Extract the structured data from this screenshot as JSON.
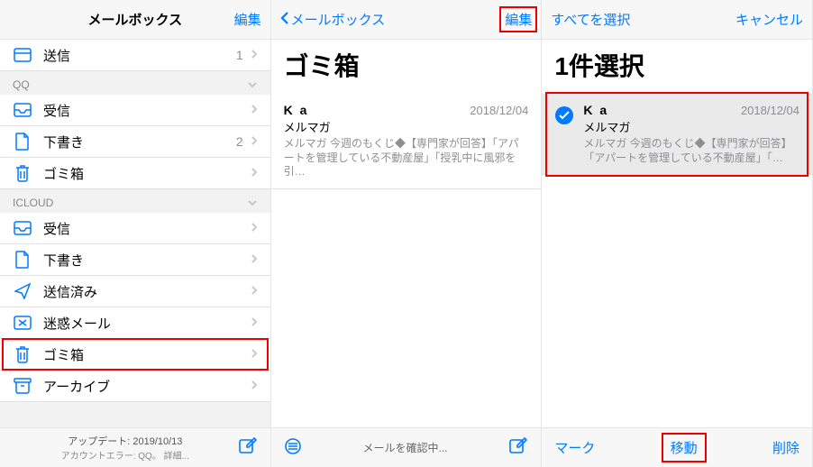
{
  "panel1": {
    "title": "メールボックス",
    "edit": "編集",
    "sent": "送信",
    "sent_count": "1",
    "group_qq": "QQ",
    "qq_inbox": "受信",
    "qq_drafts": "下書き",
    "qq_drafts_count": "2",
    "qq_trash": "ゴミ箱",
    "group_icloud": "ICLOUD",
    "ic_inbox": "受信",
    "ic_drafts": "下書き",
    "ic_sent": "送信済み",
    "ic_junk": "迷惑メール",
    "ic_trash": "ゴミ箱",
    "ic_archive": "アーカイブ",
    "footer_update": "アップデート: 2019/10/13",
    "footer_err": "アカウントエラー: QQ。 詳細..."
  },
  "panel2": {
    "back": "メールボックス",
    "edit": "編集",
    "title": "ゴミ箱",
    "mail_sender": "K a",
    "mail_date": "2018/12/04",
    "mail_subject": "メルマガ",
    "mail_preview": "メルマガ 今週のもくじ◆【専門家が回答】「アパートを管理している不動産屋」「授乳中に風邪を引…",
    "footer_status": "メールを確認中..."
  },
  "panel3": {
    "select_all": "すべてを選択",
    "cancel": "キャンセル",
    "title": "1件選択",
    "mail_sender": "K a",
    "mail_date": "2018/12/04",
    "mail_subject": "メルマガ",
    "mail_preview": "メルマガ 今週のもくじ◆【専門家が回答】「アパートを管理している不動産屋」「…",
    "mark": "マーク",
    "move": "移動",
    "delete": "削除"
  }
}
